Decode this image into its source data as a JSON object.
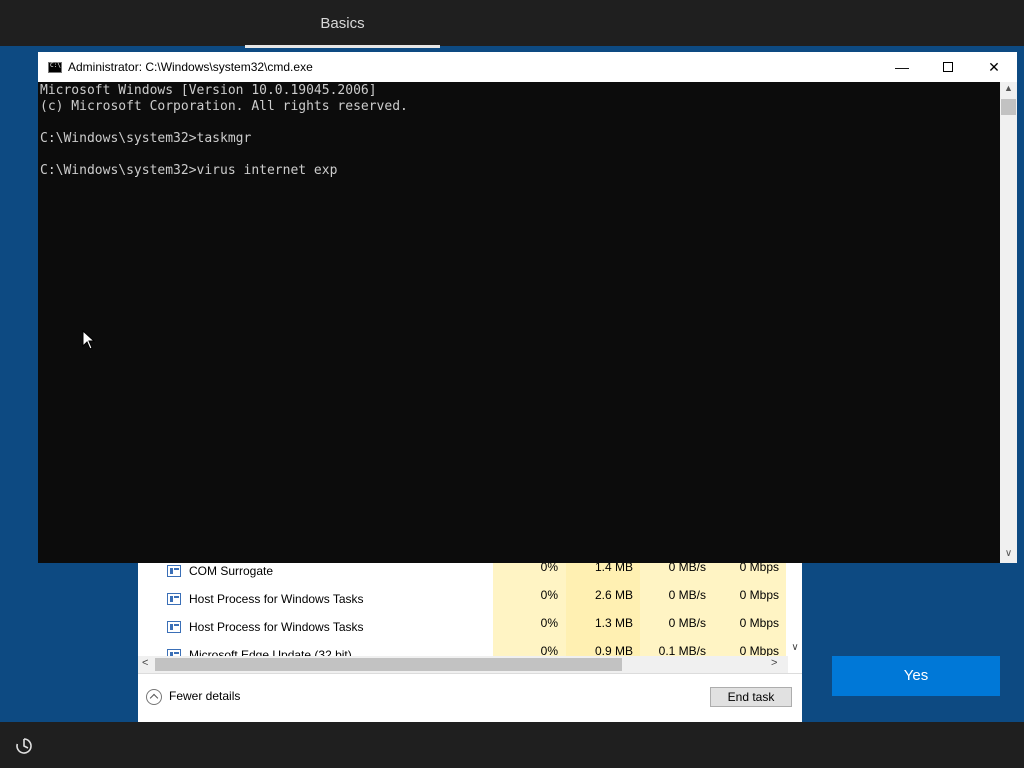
{
  "oobe": {
    "tab_label": "Basics",
    "yes_button": "Yes",
    "accessibility_icon": "accessibility-icon"
  },
  "cmd": {
    "title": "Administrator: C:\\Windows\\system32\\cmd.exe",
    "controls": {
      "minimize": "—",
      "close": "✕"
    },
    "lines": [
      "Microsoft Windows [Version 10.0.19045.2006]",
      "(c) Microsoft Corporation. All rights reserved.",
      "",
      "C:\\Windows\\system32>taskmgr",
      "",
      "C:\\Windows\\system32>virus internet exp"
    ]
  },
  "task_manager": {
    "rows": [
      {
        "name": "COM Surrogate",
        "cpu": "0%",
        "memory": "1.4 MB",
        "disk": "0 MB/s",
        "network": "0 Mbps"
      },
      {
        "name": "Host Process for Windows Tasks",
        "cpu": "0%",
        "memory": "2.6 MB",
        "disk": "0 MB/s",
        "network": "0 Mbps"
      },
      {
        "name": "Host Process for Windows Tasks",
        "cpu": "0%",
        "memory": "1.3 MB",
        "disk": "0 MB/s",
        "network": "0 Mbps"
      },
      {
        "name": "Microsoft Edge Update (32 bit)",
        "cpu": "0%",
        "memory": "0.9 MB",
        "disk": "0.1 MB/s",
        "network": "0 Mbps"
      }
    ],
    "fewer_details": "Fewer details",
    "end_task": "End task"
  }
}
